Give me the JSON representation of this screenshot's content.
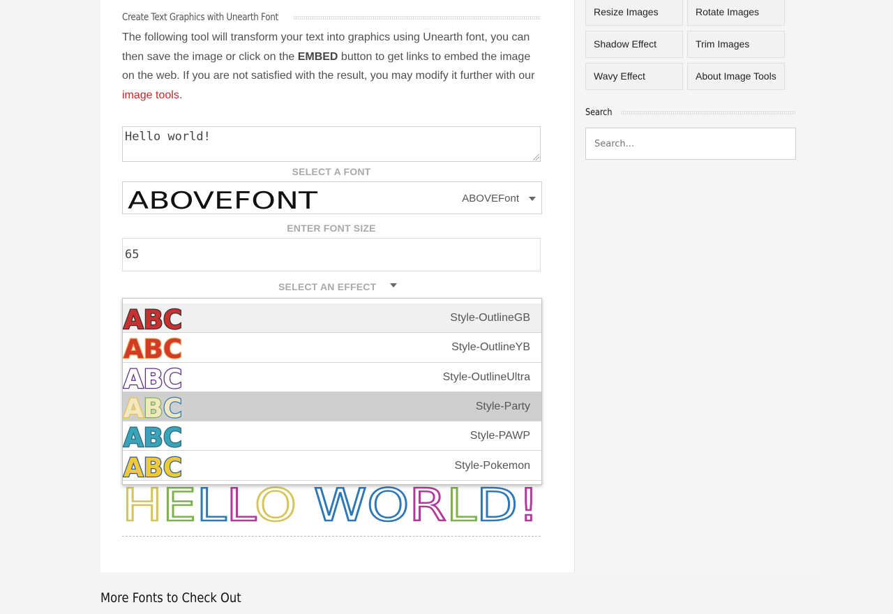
{
  "tool": {
    "heading": "Create Text Graphics with Unearth Font",
    "intro_part1": "The following tool will transform your text into graphics using Unearth font, you can then save the image or click on the ",
    "intro_embed": "EMBED",
    "intro_part2": " button to get links to embed the image on the web. If you are not satisfied with the result, you may modify it further with our ",
    "intro_link": "image tools",
    "intro_end": ".",
    "text_value": "Hello world!",
    "font_label": "SELECT A FONT",
    "font_preview": "ABOVEFONT",
    "font_name": "ABOVEFont",
    "size_label": "ENTER FONT SIZE",
    "size_value": "65",
    "effect_label": "SELECT AN EFFECT",
    "output_text": "HELLO WORLD!",
    "output_colors": [
      "#d4c45a",
      "#7bb24a",
      "#2f78b8",
      "#b23a9a",
      "#d4c45a",
      "#2f78b8",
      "#2f78b8",
      "#b23a9a",
      "#7bb24a",
      "#2f78b8",
      "#b23a9a"
    ]
  },
  "effect_dropdown": {
    "items": [
      {
        "label": "Style-OutlineGB",
        "fill": "#c93030",
        "stroke": "#333333",
        "state": "hover"
      },
      {
        "label": "Style-OutlineYB",
        "fill": "#d33a28",
        "stroke": "#e0a050",
        "state": "normal"
      },
      {
        "label": "Style-OutlineUltra",
        "fill": "#ffffff",
        "stroke": "#5b2a86",
        "state": "normal"
      },
      {
        "label": "Style-Party",
        "fill": "#f2e8c0",
        "stroke": "#e08a30",
        "state": "selected"
      },
      {
        "label": "Style-PAWP",
        "fill": "#3aa3b8",
        "stroke": "#2a6a80",
        "state": "normal"
      },
      {
        "label": "Style-Pokemon",
        "fill": "#f0c93a",
        "stroke": "#2f5aa0",
        "state": "normal"
      }
    ],
    "thumb_text": "ABC",
    "party_colors": [
      "#e8c04a",
      "#7bb24a",
      "#2f78b8"
    ]
  },
  "sidebar": {
    "buttons": [
      {
        "label": "Resize Images"
      },
      {
        "label": "Rotate Images"
      },
      {
        "label": "Shadow Effect"
      },
      {
        "label": "Trim Images"
      },
      {
        "label": "Wavy Effect"
      },
      {
        "label": "About Image Tools"
      }
    ],
    "search_heading": "Search",
    "search_placeholder": "Search..."
  },
  "footer": {
    "more_fonts": "More Fonts to Check Out"
  },
  "colors": {
    "link": "#c62828",
    "label_gray": "#a9a9a9",
    "selected_row": "#cfcfcf"
  }
}
